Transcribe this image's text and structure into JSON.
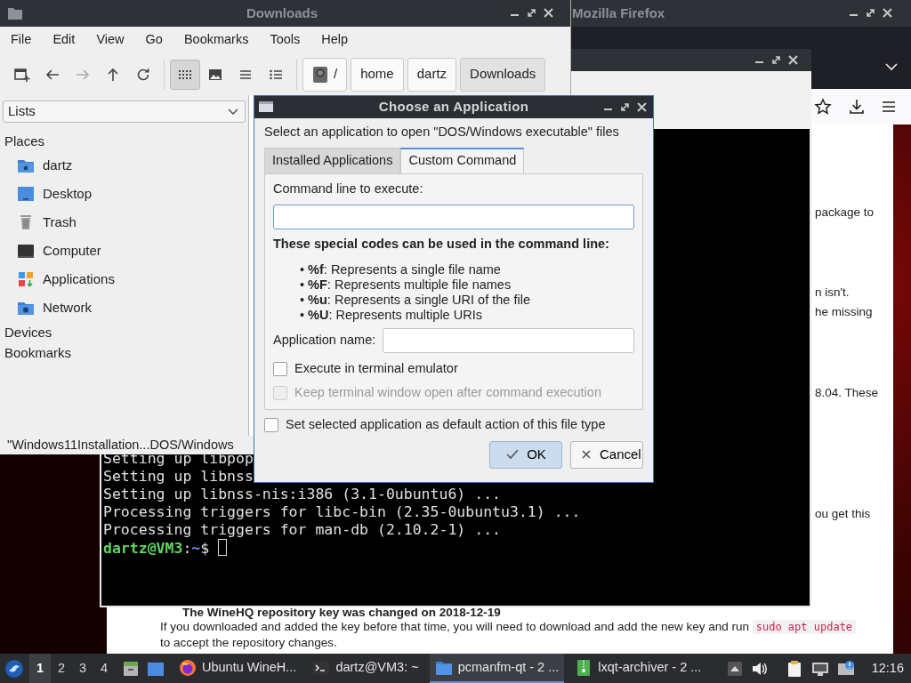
{
  "firefox": {
    "title": "Mozilla Firefox",
    "page_fragments": [
      "package to",
      "n isn't.",
      "he missing",
      "8.04. These",
      "ou get this"
    ],
    "heading": "The WineHQ repository key was changed on 2018-12-19",
    "paragraph": {
      "before": "If you downloaded and added the key before that time, you will need to download and add the new key and run",
      "code": "sudo apt update",
      "after": "to accept the repository changes."
    }
  },
  "terminal": {
    "lines": [
      "Setting up libpop",
      "Setting up libnss",
      "Setting up libnss-nis:i386 (3.1-0ubuntu6) ...",
      "Processing triggers for libc-bin (2.35-0ubuntu3.1) ...",
      "Processing triggers for man-db (2.10.2-1) ..."
    ],
    "prompt": {
      "user_host": "dartz@VM3",
      "separator": ":",
      "path": "~",
      "symbol": "$"
    }
  },
  "file_manager": {
    "title": "Downloads",
    "menu": [
      "File",
      "Edit",
      "View",
      "Go",
      "Bookmarks",
      "Tools",
      "Help"
    ],
    "navigation": [
      {
        "kind": "new-tab",
        "disabled": false
      },
      {
        "kind": "back",
        "disabled": false
      },
      {
        "kind": "forward",
        "disabled": true
      },
      {
        "kind": "up",
        "disabled": false
      },
      {
        "kind": "reload",
        "disabled": false
      }
    ],
    "view_modes": [
      {
        "kind": "icon-view",
        "selected": true
      },
      {
        "kind": "thumbnail-view",
        "selected": false
      },
      {
        "kind": "compact-view",
        "selected": false
      },
      {
        "kind": "detailed-view",
        "selected": false
      }
    ],
    "path": [
      {
        "label": "/",
        "kind": "root",
        "selected": false
      },
      {
        "label": "home",
        "kind": "folder",
        "selected": false
      },
      {
        "label": "dartz",
        "kind": "folder",
        "selected": false
      },
      {
        "label": "Downloads",
        "kind": "folder",
        "selected": true
      }
    ],
    "side_pane": {
      "mode": "Lists",
      "sections": [
        {
          "label": "Places",
          "items": [
            {
              "label": "dartz",
              "kind": "home"
            },
            {
              "label": "Desktop",
              "kind": "desktop"
            },
            {
              "label": "Trash",
              "kind": "trash"
            },
            {
              "label": "Computer",
              "kind": "computer"
            },
            {
              "label": "Applications",
              "kind": "applications"
            },
            {
              "label": "Network",
              "kind": "network"
            }
          ]
        },
        {
          "label": "Devices"
        },
        {
          "label": "Bookmarks"
        }
      ]
    },
    "status": "\"Windows11Installation...DOS/Windows"
  },
  "dialog": {
    "title": "Choose an Application",
    "prompt": "Select an application to open \"DOS/Windows executable\" files",
    "tabs": [
      {
        "label": "Installed Applications",
        "selected": false
      },
      {
        "label": "Custom Command",
        "selected": true
      }
    ],
    "command": {
      "label": "Command line to execute:",
      "focused": true
    },
    "codes_heading": "These special codes can be used in the command line:",
    "codes": [
      "• **%f**: Represents a single file name",
      "• **%F**: Represents multiple file names",
      "• **%u**: Represents a single URI of the file",
      "• **%U**: Represents multiple URIs"
    ],
    "app_name_label": "Application name:",
    "options": [
      {
        "label": "Execute in terminal emulator",
        "checked": false,
        "disabled": false
      },
      {
        "label": "Keep terminal window open after command execution",
        "checked": false,
        "disabled": true
      }
    ],
    "default_option": {
      "label": "Set selected application as default action of this file type",
      "checked": false
    },
    "buttons": [
      {
        "label": "OK",
        "kind": "ok",
        "default": true
      },
      {
        "label": "Cancel",
        "kind": "cancel",
        "default": false
      }
    ]
  },
  "taskbar": {
    "desktops": [
      {
        "label": "1",
        "selected": true
      },
      {
        "label": "2",
        "selected": false
      },
      {
        "label": "3",
        "selected": false
      },
      {
        "label": "4",
        "selected": false
      }
    ],
    "tasks": [
      {
        "label": "Ubuntu WineH...",
        "kind": "browser",
        "selected": false
      },
      {
        "label": "dartz@VM3: ~",
        "kind": "terminal",
        "selected": false
      },
      {
        "label": "pcmanfm-qt - 2 ...",
        "kind": "folder",
        "selected": true
      },
      {
        "label": "lxqt-archiver - 2 ...",
        "kind": "archive",
        "selected": false
      }
    ],
    "clock": "12:16"
  }
}
